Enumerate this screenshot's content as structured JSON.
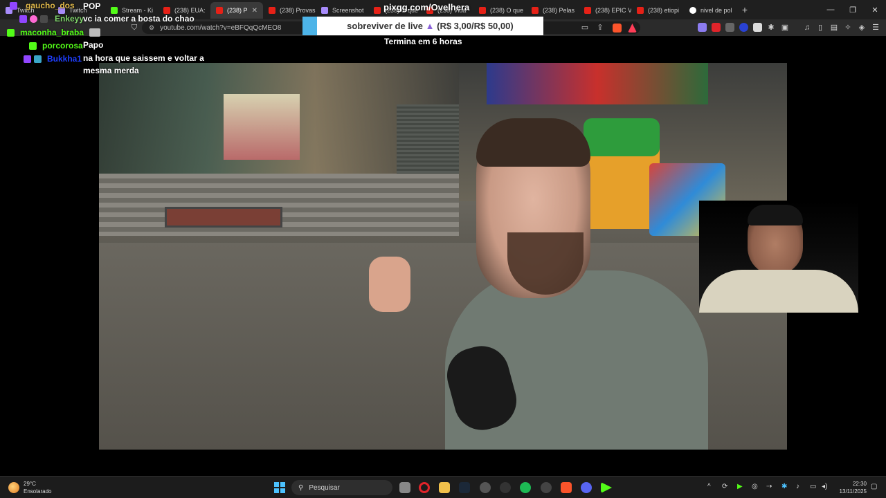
{
  "browser": {
    "tabs": [
      {
        "label": "Twitch",
        "icon": "twitch-icon"
      },
      {
        "label": "Twitch",
        "icon": "twitch-icon"
      },
      {
        "label": "Stream - Ki",
        "icon": "kick-icon"
      },
      {
        "label": "(238) EUA:",
        "icon": "youtube-icon"
      },
      {
        "label": "(238) P",
        "icon": "youtube-icon",
        "active": true
      },
      {
        "label": "(238) Provas",
        "icon": "youtube-icon"
      },
      {
        "label": "Screenshot",
        "icon": "pen-icon"
      },
      {
        "label": "(238) O que",
        "icon": "youtube-icon"
      },
      {
        "label": "(238) Vida",
        "icon": "youtube-icon"
      },
      {
        "label": "(238) O que",
        "icon": "youtube-icon"
      },
      {
        "label": "(238) Pelas",
        "icon": "youtube-icon"
      },
      {
        "label": "(238) EPIC V",
        "icon": "youtube-icon"
      },
      {
        "label": "(238) etiopi",
        "icon": "youtube-icon"
      },
      {
        "label": "nivel de pol",
        "icon": "google-icon"
      }
    ],
    "new_tab": "+",
    "url": "youtube.com/watch?v=eBFQqQcMEO8",
    "window_controls": {
      "minimize": "—",
      "restore": "❐",
      "close": "✕"
    },
    "tab_close": "✕"
  },
  "chat": {
    "messages": [
      {
        "user": "gaucho_dos",
        "user_color": "#e0b84a",
        "text": "POP"
      },
      {
        "user": "Enkeyy",
        "user_color": "#7fd46b",
        "text": "vc ia comer a bosta do chao"
      },
      {
        "user": "maconha_braba",
        "user_color": "#53fc18",
        "text": ""
      },
      {
        "user": "porcorosa",
        "user_color": "#53fc18",
        "text": "Papo"
      },
      {
        "user": "Bukkha1",
        "user_color": "#1f3fff",
        "text": "na hora que saissem e voltar a"
      },
      {
        "user": "",
        "user_color": "#ffffff",
        "text": "mesma merda"
      }
    ]
  },
  "donation": {
    "title": "pixgg.com/Ovelhera",
    "goal_label": "sobreviver de live",
    "amount": "(R$ 3,00/R$ 50,00)",
    "progress": 0.06,
    "timer": "Termina em 6 horas",
    "fill_color": "#4db4e8"
  },
  "taskbar": {
    "weather_temp": "29°C",
    "weather_desc": "Ensolarado",
    "search_placeholder": "Pesquisar",
    "time": "22:30",
    "date": "13/11/2025"
  }
}
